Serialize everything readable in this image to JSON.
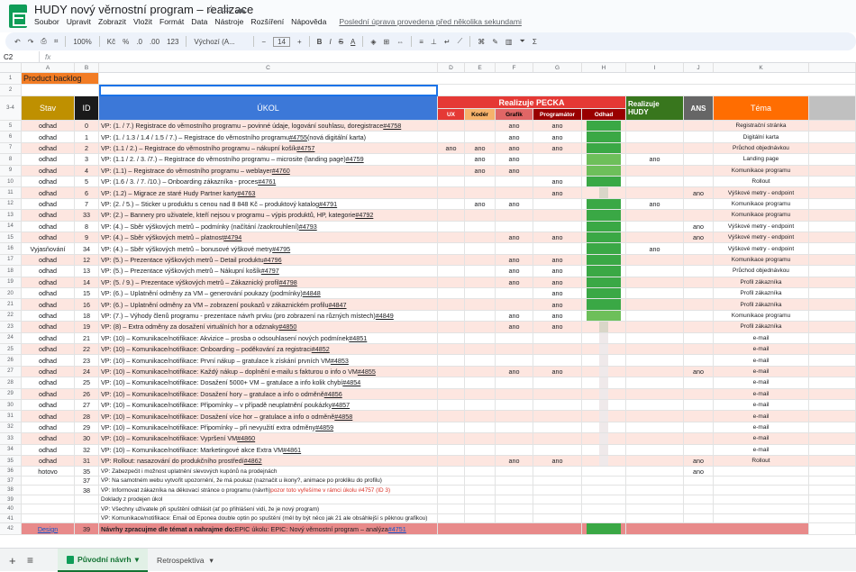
{
  "app": {
    "title": "HUDY nový věrnostní program – realizace",
    "menus": [
      "Soubor",
      "Upravit",
      "Zobrazit",
      "Vložit",
      "Formát",
      "Data",
      "Nástroje",
      "Rozšíření",
      "Nápověda"
    ],
    "last_edit": "Poslední úprava provedena před několika sekundami"
  },
  "toolbar": {
    "zoom": "100%",
    "currency": "Kč",
    "percent": "%",
    "dec_down": ".0",
    "dec_up": ".00",
    "format_123": "123",
    "font": "Výchozí (A...",
    "font_size": "14",
    "bold": "B",
    "italic": "I",
    "strike": "S",
    "text_color": "A"
  },
  "formula_bar": {
    "cell_ref": "C2",
    "fx": "fx"
  },
  "columns": [
    "A",
    "B",
    "C",
    "D",
    "E",
    "F",
    "G",
    "H",
    "I",
    "J",
    "K"
  ],
  "header": {
    "product_backlog": "Product backlog",
    "stav": "Stav",
    "id": "ID",
    "ukol": "ÚKOL",
    "realizuje_pecka": "Realizuje PECKA",
    "ux": "UX",
    "koder": "Kodér",
    "grafik": "Grafik",
    "programator": "Programátor",
    "odhad": "Odhad",
    "realizuje_hudy": "Realizuje HUDY",
    "ans": "ANS",
    "tema": "Téma"
  },
  "rows": [
    {
      "n": "5",
      "stav": "odhad",
      "id": "0",
      "ukol": "VP: (1. / 7.) Registrace do věrnostního programu – povinné údaje, logování souhlasu, doregistrace ",
      "link": "#4758",
      "ux": "",
      "koder": "",
      "grafik": "ano",
      "prog": "ano",
      "hudy": "",
      "ans": "",
      "tema": "Registrační stránka",
      "bg": "#fde6e0",
      "h": "#3aa845"
    },
    {
      "n": "6",
      "stav": "odhad",
      "id": "1",
      "ukol": "VP: (1. / 1.3 / 1.4 / 1.5 / 7.) – Registrace do věrnostního programu ",
      "link": "#4755",
      "suffix": " (nová digitální karta)",
      "ux": "",
      "koder": "",
      "grafik": "ano",
      "prog": "ano",
      "hudy": "",
      "ans": "",
      "tema": "Digitální karta",
      "bg": "#ffffff",
      "h": "#3aa845"
    },
    {
      "n": "7",
      "stav": "odhad",
      "id": "2",
      "ukol": "VP: (1.1 / 2.) – Registrace do věrnostního programu – nákupní košík ",
      "link": "#4757",
      "ux": "ano",
      "koder": "ano",
      "grafik": "ano",
      "prog": "ano",
      "hudy": "",
      "ans": "",
      "tema": "Průchod objednávkou",
      "bg": "#fde6e0",
      "h": "#3aa845"
    },
    {
      "n": "8",
      "stav": "odhad",
      "id": "3",
      "ukol": "VP: (1.1 / 2. / 3. /7.) – Registrace do věrnostního programu – microsite (landing page) ",
      "link": "#4759",
      "ux": "",
      "koder": "ano",
      "grafik": "ano",
      "prog": "",
      "hudy": "ano",
      "ans": "",
      "tema": "Landing page",
      "bg": "#ffffff",
      "h": "#6dbf5a"
    },
    {
      "n": "9",
      "stav": "odhad",
      "id": "4",
      "ukol": "VP: (1.1) – Registrace do věrnostního programu – weblayer ",
      "link": "#4760",
      "ux": "",
      "koder": "ano",
      "grafik": "ano",
      "prog": "",
      "hudy": "",
      "ans": "",
      "tema": "Komunikace programu",
      "bg": "#fde6e0",
      "h": "#6dbf5a"
    },
    {
      "n": "10",
      "stav": "odhad",
      "id": "5",
      "ukol": "VP: (1.6 / 3. / 7. /10.) – Onboarding zákazníka - proces ",
      "link": "#4761",
      "ux": "",
      "koder": "",
      "grafik": "",
      "prog": "ano",
      "hudy": "",
      "ans": "",
      "tema": "Rollout",
      "bg": "#ffffff",
      "h": "#3aa845"
    },
    {
      "n": "11",
      "stav": "odhad",
      "id": "6",
      "ukol": "VP: (1.2) – Migrace ze staré Hudy Partner karty ",
      "link": "#4763",
      "ux": "",
      "koder": "",
      "grafik": "",
      "prog": "ano",
      "hudy": "",
      "ans": "ano",
      "tema": "Výškové metry - endpoint",
      "bg": "#fde6e0",
      "h": "#d9d6c8"
    },
    {
      "n": "12",
      "stav": "odhad",
      "id": "7",
      "ukol": "VP: (2. / 5.) – Sticker u produktu s cenou nad 8 848 Kč – produktový katalog ",
      "link": "#4791",
      "ux": "",
      "koder": "ano",
      "grafik": "ano",
      "prog": "",
      "hudy": "ano",
      "ans": "",
      "tema": "Komunikace programu",
      "bg": "#ffffff",
      "h": "#3aa845"
    },
    {
      "n": "13",
      "stav": "odhad",
      "id": "33",
      "ukol": "VP: (2.) – Bannery pro uživatele, kteří nejsou v programu – výpis produktů, HP, kategorie ",
      "link": "#4792",
      "ux": "",
      "koder": "",
      "grafik": "",
      "prog": "",
      "hudy": "",
      "ans": "",
      "tema": "Komunikace programu",
      "bg": "#fde6e0",
      "h": "#3aa845"
    },
    {
      "n": "14",
      "stav": "odhad",
      "id": "8",
      "ukol": "VP: (4.) – Sběr výškových metrů – podmínky (načítání /zaokrouhlení) ",
      "link": "#4793",
      "ux": "",
      "koder": "",
      "grafik": "",
      "prog": "",
      "hudy": "",
      "ans": "ano",
      "tema": "Výškové metry - endpoint",
      "bg": "#ffffff",
      "h": "#3aa845"
    },
    {
      "n": "15",
      "stav": "odhad",
      "id": "9",
      "ukol": "VP: (4.) – Sběr výškových metrů – platnost ",
      "link": "#4794",
      "ux": "",
      "koder": "",
      "grafik": "ano",
      "prog": "ano",
      "hudy": "",
      "ans": "ano",
      "tema": "Výškové metry - endpoint",
      "bg": "#fde6e0",
      "h": "#3aa845"
    },
    {
      "n": "16",
      "stav": "Vyjasňování",
      "id": "34",
      "ukol": "VP: (4.) – Sběr výškových metrů – bonusové výškové metry ",
      "link": "#4795",
      "ux": "",
      "koder": "",
      "grafik": "",
      "prog": "",
      "hudy": "ano",
      "ans": "",
      "tema": "Výškové metry - endpoint",
      "bg": "#ffffff",
      "h": "#3aa845"
    },
    {
      "n": "17",
      "stav": "odhad",
      "id": "12",
      "ukol": "VP: (5.) – Prezentace výškových metrů – Detail produktu ",
      "link": "#4796",
      "ux": "",
      "koder": "",
      "grafik": "ano",
      "prog": "ano",
      "hudy": "",
      "ans": "",
      "tema": "Komunikace programu",
      "bg": "#fde6e0",
      "h": "#3aa845"
    },
    {
      "n": "18",
      "stav": "odhad",
      "id": "13",
      "ukol": "VP: (5.) – Prezentace výškových metrů – Nákupní košík ",
      "link": "#4797",
      "ux": "",
      "koder": "",
      "grafik": "ano",
      "prog": "ano",
      "hudy": "",
      "ans": "",
      "tema": "Průchod objednávkou",
      "bg": "#ffffff",
      "h": "#3aa845"
    },
    {
      "n": "19",
      "stav": "odhad",
      "id": "14",
      "ukol": "VP: (5. / 9.) – Prezentace výškových metrů – Zákaznický profil ",
      "link": "#4798",
      "ux": "",
      "koder": "",
      "grafik": "ano",
      "prog": "ano",
      "hudy": "",
      "ans": "",
      "tema": "Profil zákazníka",
      "bg": "#fde6e0",
      "h": "#3aa845"
    },
    {
      "n": "20",
      "stav": "odhad",
      "id": "15",
      "ukol": "VP: (6.) – Uplatnění odměny za VM – generování poukazy (podmínky) ",
      "link": "#4848",
      "ux": "",
      "koder": "",
      "grafik": "",
      "prog": "ano",
      "hudy": "",
      "ans": "",
      "tema": "Profil zákazníka",
      "bg": "#ffffff",
      "h": "#3aa845"
    },
    {
      "n": "21",
      "stav": "odhad",
      "id": "16",
      "ukol": "VP: (6.) – Uplatnění odměny za VM – zobrazení poukazů v zákaznickém profilu ",
      "link": "#4847",
      "ux": "",
      "koder": "",
      "grafik": "",
      "prog": "ano",
      "hudy": "",
      "ans": "",
      "tema": "Profil zákazníka",
      "bg": "#fde6e0",
      "h": "#3aa845"
    },
    {
      "n": "22",
      "stav": "odhad",
      "id": "18",
      "ukol": "VP: (7.) – Výhody členů programu - prezentace návrh prvku (pro zobrazení na různých místech) ",
      "link": "#4849",
      "ux": "",
      "koder": "",
      "grafik": "ano",
      "prog": "ano",
      "hudy": "",
      "ans": "",
      "tema": "Komunikace programu",
      "bg": "#ffffff",
      "h": "#6dbf5a"
    },
    {
      "n": "23",
      "stav": "odhad",
      "id": "19",
      "ukol": "VP: (8) – Extra odměny za dosažení virtuálních hor a odznaky ",
      "link": "#4850",
      "ux": "",
      "koder": "",
      "grafik": "ano",
      "prog": "ano",
      "hudy": "",
      "ans": "",
      "tema": "Profil zákazníka",
      "bg": "#fde6e0",
      "h": "#d9d6c8"
    },
    {
      "n": "24",
      "stav": "odhad",
      "id": "21",
      "ukol": "VP: (10) – Komunikace/notifikace: Akvizice – prosba o odsouhlasení nových podmínek ",
      "link": "#4851",
      "ux": "",
      "koder": "",
      "grafik": "",
      "prog": "",
      "hudy": "",
      "ans": "",
      "tema": "e-mail",
      "bg": "#ffffff",
      "h": "#efe9ea"
    },
    {
      "n": "25",
      "stav": "odhad",
      "id": "22",
      "ukol": "VP: (10) – Komunikace/notifikace: Onboarding – poděkování za registraci ",
      "link": "#4852",
      "ux": "",
      "koder": "",
      "grafik": "",
      "prog": "",
      "hudy": "",
      "ans": "",
      "tema": "e-mail",
      "bg": "#fde6e0",
      "h": "#efe9ea"
    },
    {
      "n": "26",
      "stav": "odhad",
      "id": "23",
      "ukol": "VP: (10) – Komunikace/notifikace: První nákup – gratulace k získání prvních VM ",
      "link": "#4853",
      "ux": "",
      "koder": "",
      "grafik": "",
      "prog": "",
      "hudy": "",
      "ans": "",
      "tema": "e-mail",
      "bg": "#ffffff",
      "h": "#efe9ea"
    },
    {
      "n": "27",
      "stav": "odhad",
      "id": "24",
      "ukol": "VP: (10) – Komunikace/notifikace: Každý nákup – doplnění e-mailu s fakturou o info o VM ",
      "link": "#4855",
      "ux": "",
      "koder": "",
      "grafik": "ano",
      "prog": "ano",
      "hudy": "",
      "ans": "ano",
      "tema": "e-mail",
      "bg": "#fde6e0",
      "h": "#efe9ea"
    },
    {
      "n": "28",
      "stav": "odhad",
      "id": "25",
      "ukol": "VP: (10) – Komunikace/notifikace: Dosažení 5000+ VM – gratulace a info kolik chybí ",
      "link": "#4854",
      "ux": "",
      "koder": "",
      "grafik": "",
      "prog": "",
      "hudy": "",
      "ans": "",
      "tema": "e-mail",
      "bg": "#ffffff",
      "h": "#efe9ea"
    },
    {
      "n": "29",
      "stav": "odhad",
      "id": "26",
      "ukol": "VP: (10) – Komunikace/notifikace: Dosažení hory – gratulace a info o odměně ",
      "link": "#4856",
      "ux": "",
      "koder": "",
      "grafik": "",
      "prog": "",
      "hudy": "",
      "ans": "",
      "tema": "e-mail",
      "bg": "#fde6e0",
      "h": "#efe9ea"
    },
    {
      "n": "30",
      "stav": "odhad",
      "id": "27",
      "ukol": "VP: (10) – Komunikace/notifikace: Připomínky – v případě neuplatnění poukázky ",
      "link": "#4857",
      "ux": "",
      "koder": "",
      "grafik": "",
      "prog": "",
      "hudy": "",
      "ans": "",
      "tema": "e-mail",
      "bg": "#ffffff",
      "h": "#efe9ea"
    },
    {
      "n": "31",
      "stav": "odhad",
      "id": "28",
      "ukol": "VP: (10) – Komunikace/notifikace: Dosažení více hor – gratulace a info o odměně ",
      "link": "#4858",
      "ux": "",
      "koder": "",
      "grafik": "",
      "prog": "",
      "hudy": "",
      "ans": "",
      "tema": "e-mail",
      "bg": "#fde6e0",
      "h": "#efe9ea"
    },
    {
      "n": "32",
      "stav": "odhad",
      "id": "29",
      "ukol": "VP: (10) – Komunikace/notifikace: Připomínky – při nevyužití extra odměny ",
      "link": "#4859",
      "ux": "",
      "koder": "",
      "grafik": "",
      "prog": "",
      "hudy": "",
      "ans": "",
      "tema": "e-mail",
      "bg": "#ffffff",
      "h": "#efe9ea"
    },
    {
      "n": "33",
      "stav": "odhad",
      "id": "30",
      "ukol": "VP: (10) – Komunikace/notifikace: Vypršení VM ",
      "link": "#4860",
      "ux": "",
      "koder": "",
      "grafik": "",
      "prog": "",
      "hudy": "",
      "ans": "",
      "tema": "e-mail",
      "bg": "#fde6e0",
      "h": "#efe9ea"
    },
    {
      "n": "34",
      "stav": "odhad",
      "id": "32",
      "ukol": "VP: (10) – Komunikace/notifikace: Marketingové akce Extra VM ",
      "link": "#4861",
      "ux": "",
      "koder": "",
      "grafik": "",
      "prog": "",
      "hudy": "",
      "ans": "",
      "tema": "e-mail",
      "bg": "#ffffff",
      "h": "#efe9ea"
    },
    {
      "n": "35",
      "stav": "odhad",
      "id": "31",
      "ukol": "VP: Rollout: nasazování do produkčního prostředí ",
      "link": "#4862",
      "ux": "",
      "koder": "",
      "grafik": "ano",
      "prog": "ano",
      "hudy": "",
      "ans": "ano",
      "tema": "Rollout",
      "bg": "#fde6e0",
      "h": "#efe9ea"
    },
    {
      "n": "36",
      "stav": "hotovo",
      "id": "35",
      "ukol": "VP: Zabezpečit i možnost uplatnění slevových kupónů na prodejnách",
      "link": "",
      "ux": "",
      "koder": "",
      "grafik": "",
      "prog": "",
      "hudy": "",
      "ans": "ano",
      "tema": "",
      "bg": "#ffffff",
      "h": "#ffffff",
      "small": true
    },
    {
      "n": "37",
      "stav": "",
      "id": "37",
      "ukol": "VP: Na samotném webu vytvořit upozornění, že má poukaz (naznačit u ikony?, animace po prokliku do profilu)",
      "link": "",
      "ux": "",
      "koder": "",
      "grafik": "",
      "prog": "",
      "hudy": "",
      "ans": "",
      "tema": "",
      "bg": "#ffffff",
      "h": "#ffffff",
      "small": true
    },
    {
      "n": "38",
      "stav": "",
      "id": "38",
      "ukol": "VP: Informovat zákazníka na děkovací stránce o programu (návrh) ",
      "red": "pozor toto vyřešíme v rámci úkolu #4757 (ID 3)",
      "link": "",
      "ux": "",
      "koder": "",
      "grafik": "",
      "prog": "",
      "hudy": "",
      "ans": "",
      "tema": "",
      "bg": "#ffffff",
      "h": "#ffffff",
      "small": true
    },
    {
      "n": "39",
      "stav": "",
      "id": "",
      "ukol": "Doklady z prodejen úkol",
      "link": "",
      "ux": "",
      "koder": "",
      "grafik": "",
      "prog": "",
      "hudy": "",
      "ans": "",
      "tema": "",
      "bg": "#ffffff",
      "h": "#ffffff",
      "small": true
    },
    {
      "n": "40",
      "stav": "",
      "id": "",
      "ukol": "VP: Všechny uživatele při spuštění odhlásit (ať po přihlášení vidí, že je nový program)",
      "link": "",
      "ux": "",
      "koder": "",
      "grafik": "",
      "prog": "",
      "hudy": "",
      "ans": "",
      "tema": "",
      "bg": "#ffffff",
      "h": "#ffffff",
      "small": true
    },
    {
      "n": "41",
      "stav": "",
      "id": "",
      "ukol": "VP: Komunikace/notifikace: Email od Eponea double optin po spuštění  (měl by být něco jak 21 ale obsáhlejší s pěknou grafikou)",
      "link": "",
      "ux": "",
      "koder": "",
      "grafik": "",
      "prog": "",
      "hudy": "",
      "ans": "",
      "tema": "",
      "bg": "#ffffff",
      "h": "#ffffff",
      "small": true
    }
  ],
  "design_row": {
    "n": "42",
    "stav": "Design",
    "id": "39",
    "bold": "Návrhy zpracujme dle témat a nahrajme do: ",
    "text": "EPIC úkolu: EPIC: Nový věrnostní program – analýza ",
    "link": "#4751"
  },
  "tabs": {
    "add": "+",
    "list": "≡",
    "active": "Původní návrh",
    "other": "Retrospektiva"
  }
}
